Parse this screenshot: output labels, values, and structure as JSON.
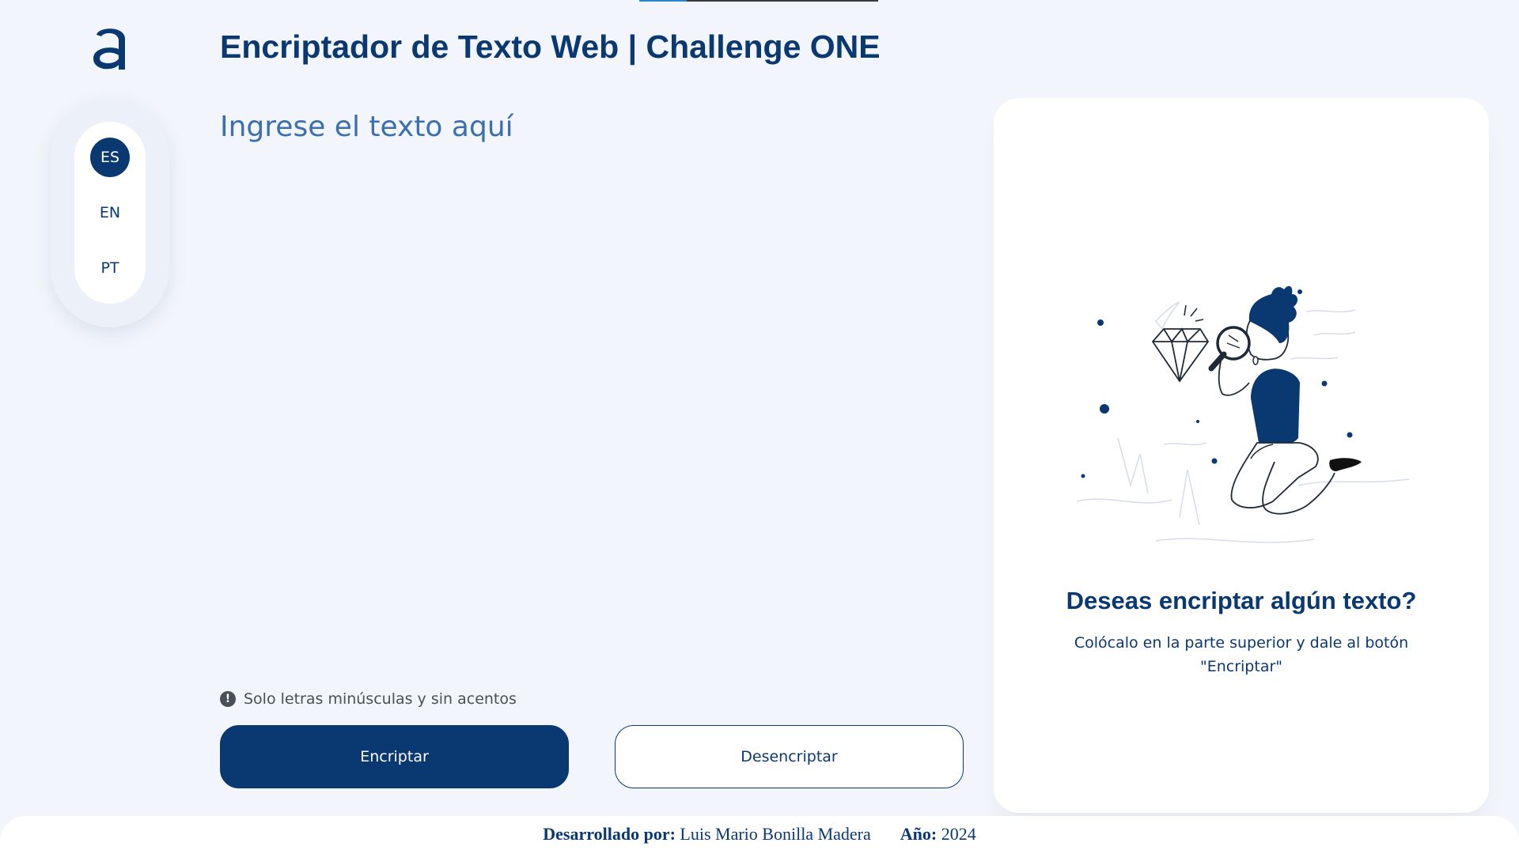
{
  "header": {
    "logo_icon": "alura-a-logo-icon",
    "title": "Encriptador de Texto Web | Challenge ONE"
  },
  "languages": [
    {
      "code": "ES",
      "active": true
    },
    {
      "code": "EN",
      "active": false
    },
    {
      "code": "PT",
      "active": false
    }
  ],
  "editor": {
    "placeholder": "Ingrese el texto aquí",
    "value": ""
  },
  "notice": {
    "icon": "exclamation-circle-icon",
    "text": "Solo letras minúsculas y sin acentos"
  },
  "actions": {
    "encrypt_label": "Encriptar",
    "decrypt_label": "Desencriptar"
  },
  "output_card": {
    "illustration": "person-magnifying-glass-diamond-illustration",
    "title": "Deseas encriptar algún texto?",
    "message": "Colócalo en la parte superior y dale al botón \"Encriptar\""
  },
  "footer": {
    "author_label": "Desarrollado por:",
    "author": "Luis Mario Bonilla Madera",
    "year_label": "Año:",
    "year": "2024"
  },
  "colors": {
    "primary": "#0a3871",
    "background": "#f3f5fc",
    "card": "#ffffff",
    "muted": "#495057"
  }
}
